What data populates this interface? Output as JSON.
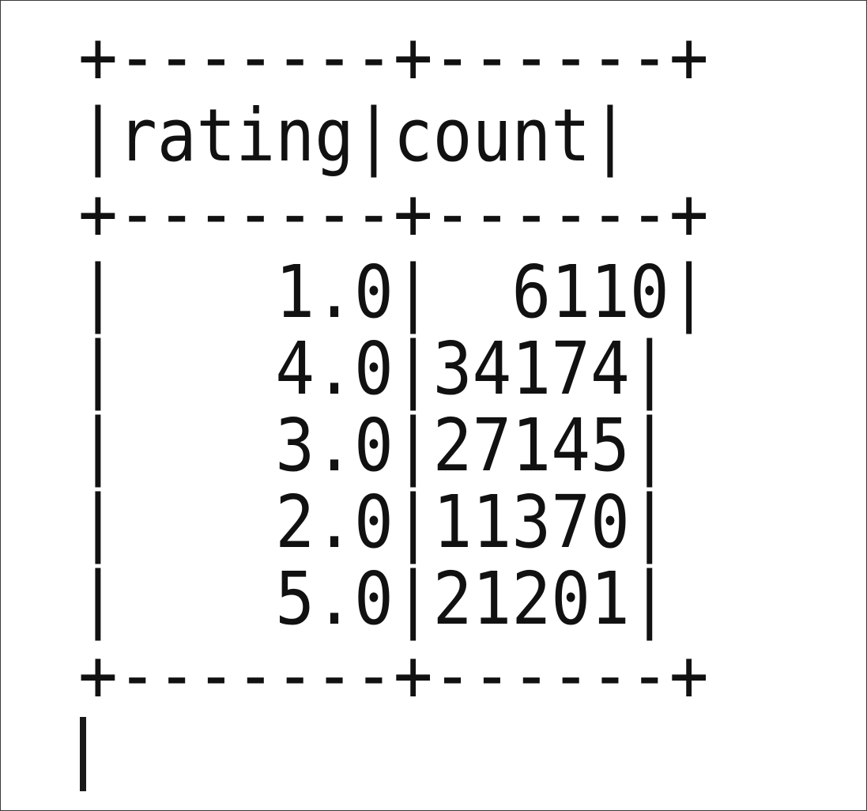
{
  "table": {
    "border_top": "+-------+------+",
    "header_row": "|rating|count|",
    "header_divider": "+-------+------+",
    "columns": [
      "rating",
      "count"
    ],
    "rows": [
      {
        "rating": "1.0",
        "count": "6110"
      },
      {
        "rating": "4.0",
        "count": "34174"
      },
      {
        "rating": "3.0",
        "count": "27145"
      },
      {
        "rating": "2.0",
        "count": "11370"
      },
      {
        "rating": "5.0",
        "count": "21201"
      }
    ],
    "border_bottom": "+-------+------+"
  },
  "lines": {
    "top": "+-------+------+",
    "header": "|rating|count|",
    "divider": "+-------+------+",
    "row_0": "|    1.0|  6110|",
    "row_1": "|    4.0|34174|",
    "row_2": "|    3.0|27145|",
    "row_3": "|    2.0|11370|",
    "row_4": "|    5.0|21201|",
    "bottom": "+-------+------+"
  },
  "colors": {
    "text": "#111111",
    "border": "#3b3b3b",
    "background": "#ffffff"
  }
}
